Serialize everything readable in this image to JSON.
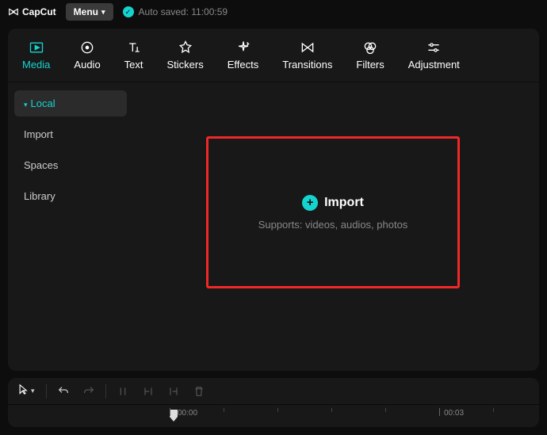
{
  "titlebar": {
    "appName": "CapCut",
    "menuLabel": "Menu",
    "autosave": "Auto saved: 11:00:59"
  },
  "tabs": [
    {
      "id": "media",
      "label": "Media"
    },
    {
      "id": "audio",
      "label": "Audio"
    },
    {
      "id": "text",
      "label": "Text"
    },
    {
      "id": "stickers",
      "label": "Stickers"
    },
    {
      "id": "effects",
      "label": "Effects"
    },
    {
      "id": "transitions",
      "label": "Transitions"
    },
    {
      "id": "filters",
      "label": "Filters"
    },
    {
      "id": "adjustment",
      "label": "Adjustment"
    }
  ],
  "sidebar": {
    "items": [
      {
        "id": "local",
        "label": "Local"
      },
      {
        "id": "import",
        "label": "Import"
      },
      {
        "id": "spaces",
        "label": "Spaces"
      },
      {
        "id": "library",
        "label": "Library"
      }
    ]
  },
  "dropzone": {
    "title": "Import",
    "subtitle": "Supports: videos, audios, photos"
  },
  "timeline": {
    "ticks": [
      {
        "label": "00:00",
        "pos": 0
      },
      {
        "label": "00:03",
        "pos": 340
      }
    ]
  }
}
